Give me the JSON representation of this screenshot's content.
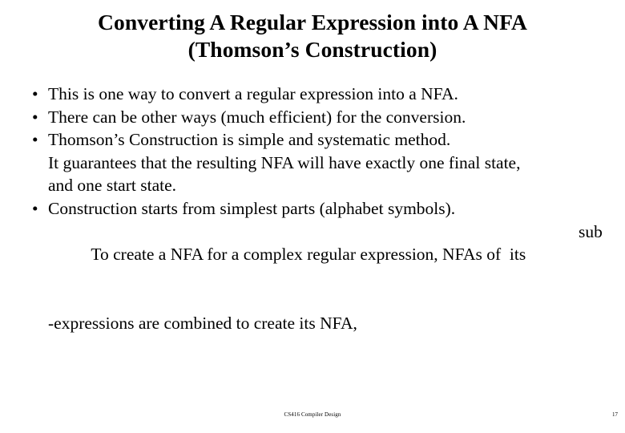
{
  "slide": {
    "background_color": "#ffffff",
    "text_color": "#000000",
    "title": {
      "line1": "Converting A Regular Expression into A NFA",
      "line2": "(Thomson’s Construction)"
    },
    "bullets": [
      {
        "marker": "•",
        "lines": [
          "This is one way to convert a regular expression into a NFA."
        ]
      },
      {
        "marker": "•",
        "lines": [
          "There can be other ways (much efficient) for the conversion."
        ]
      },
      {
        "marker": "•",
        "lines": [
          "Thomson’s Construction is simple and systematic method.",
          "It guarantees that the resulting NFA will have exactly one final state,",
          "and one start state."
        ]
      },
      {
        "marker": "•",
        "lines": [
          "Construction starts from simplest parts (alphabet symbols).",
          "To create a NFA for a complex regular expression, NFAs of  its",
          "-expressions are combined to create its NFA,"
        ],
        "orphan_word": "sub",
        "orphan_on_line_index": 1
      }
    ],
    "footer": {
      "course": "CS416 Compiler Design",
      "page_number": "17"
    }
  }
}
